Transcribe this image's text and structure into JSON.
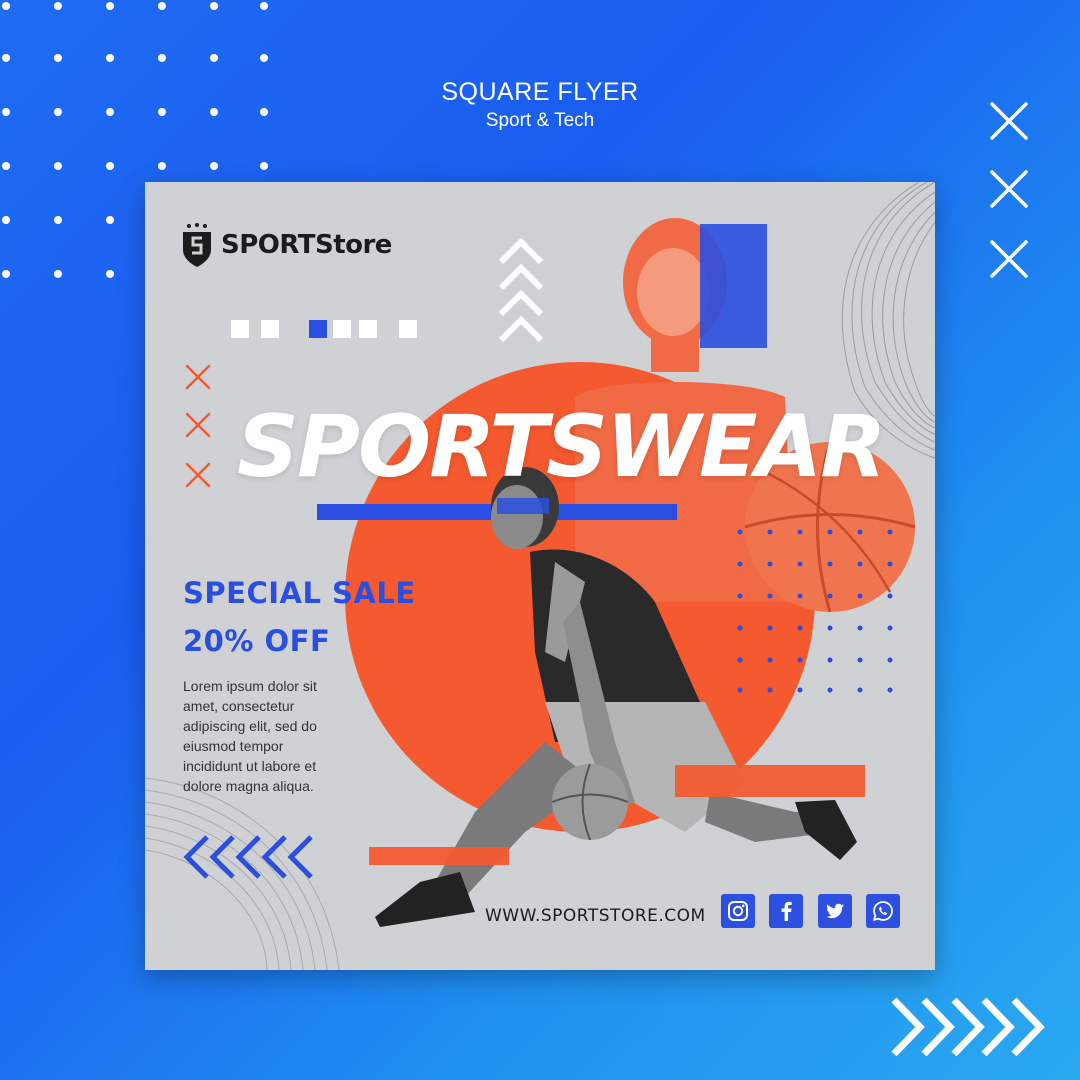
{
  "header": {
    "title": "SQUARE FLYER",
    "subtitle": "Sport & Tech"
  },
  "flyer": {
    "brand": "SPORTStore",
    "headline": "SPORTSWEAR",
    "sale_line1": "SPECIAL SALE",
    "sale_line2": "20% OFF",
    "body": "Lorem ipsum dolor sit\namet, consectetur\nadipiscing elit, sed do\neiusmod tempor\nincididunt ut labore et\ndolore magna aliqua.",
    "website": "WWW.SPORTSTORE.COM",
    "social_icons": [
      "instagram-icon",
      "facebook-icon",
      "twitter-icon",
      "whatsapp-icon"
    ]
  },
  "colors": {
    "background_blue": "#1f6cf2",
    "accent_blue": "#2d50e0",
    "accent_orange": "#f4592f",
    "flyer_gray": "#cfd1d4"
  }
}
